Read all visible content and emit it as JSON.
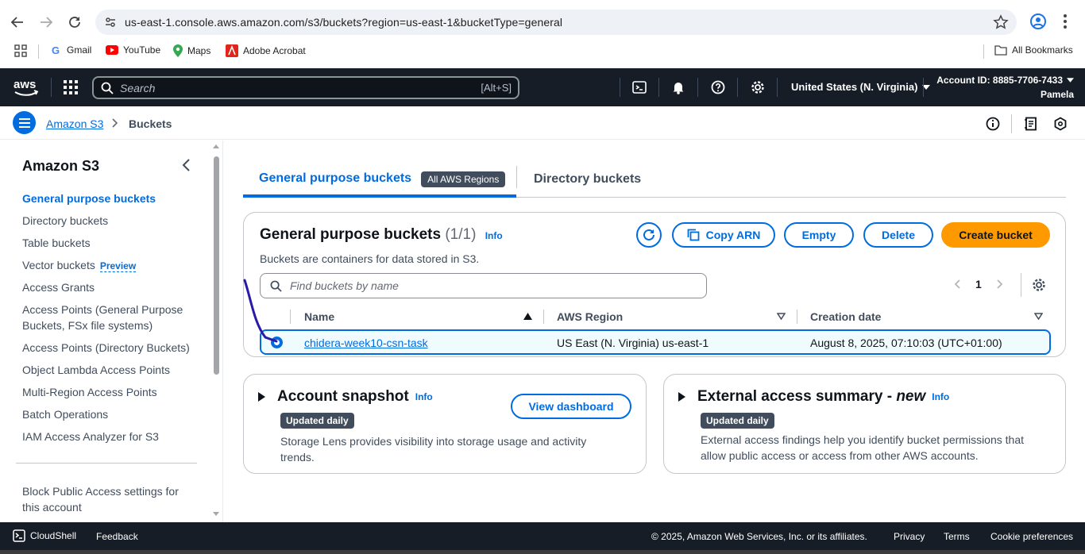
{
  "browser": {
    "url": "us-east-1.console.aws.amazon.com/s3/buckets?region=us-east-1&bucketType=general",
    "bookmarks": [
      "Gmail",
      "YouTube",
      "Maps",
      "Adobe Acrobat"
    ],
    "all_bookmarks": "All Bookmarks"
  },
  "topnav": {
    "logo": "aws",
    "search_placeholder": "Search",
    "search_shortcut": "[Alt+S]",
    "region": "United States (N. Virginia)",
    "account_id": "Account ID: 8885-7706-7433",
    "user": "Pamela",
    "icons": [
      "cloudshell-icon",
      "bell-icon",
      "help-icon",
      "settings-icon"
    ]
  },
  "breadcrumb": {
    "items": [
      "Amazon S3",
      "Buckets"
    ]
  },
  "sidebar": {
    "title": "Amazon S3",
    "items": [
      {
        "label": "General purpose buckets",
        "active": true
      },
      {
        "label": "Directory buckets"
      },
      {
        "label": "Table buckets"
      },
      {
        "label": "Vector buckets",
        "tag": "Preview"
      },
      {
        "label": "Access Grants"
      },
      {
        "label": "Access Points (General Purpose Buckets, FSx file systems)"
      },
      {
        "label": "Access Points (Directory Buckets)"
      },
      {
        "label": "Object Lambda Access Points"
      },
      {
        "label": "Multi-Region Access Points"
      },
      {
        "label": "Batch Operations"
      },
      {
        "label": "IAM Access Analyzer for S3"
      }
    ],
    "bottom_item": "Block Public Access settings for this account"
  },
  "tabs": {
    "general": "General purpose buckets",
    "general_badge": "All AWS Regions",
    "directory": "Directory buckets"
  },
  "buckets_panel": {
    "title": "General purpose buckets",
    "count": "(1/1)",
    "info": "Info",
    "description": "Buckets are containers for data stored in S3.",
    "buttons": {
      "copy_arn": "Copy ARN",
      "empty": "Empty",
      "delete": "Delete",
      "create": "Create bucket"
    },
    "search_placeholder": "Find buckets by name",
    "page": "1",
    "columns": [
      "Name",
      "AWS Region",
      "Creation date"
    ],
    "rows": [
      {
        "name": "chidera-week10-csn-task",
        "region": "US East (N. Virginia) us-east-1",
        "created": "August 8, 2025, 07:10:03 (UTC+01:00)",
        "selected": true
      }
    ]
  },
  "account_snapshot": {
    "title": "Account snapshot",
    "info": "Info",
    "badge": "Updated daily",
    "description": "Storage Lens provides visibility into storage usage and activity trends.",
    "button": "View dashboard"
  },
  "external_access": {
    "title": "External access summary - ",
    "title_new": "new",
    "info": "Info",
    "badge": "Updated daily",
    "description": "External access findings help you identify bucket permissions that allow public access or access from other AWS accounts."
  },
  "footer": {
    "cloudshell": "CloudShell",
    "feedback": "Feedback",
    "copyright": "© 2025, Amazon Web Services, Inc. or its affiliates.",
    "privacy": "Privacy",
    "terms": "Terms",
    "cookies": "Cookie preferences"
  },
  "colors": {
    "aws_nav": "#161d26",
    "link_blue": "#006ce0",
    "primary_orange": "#ff9900"
  }
}
